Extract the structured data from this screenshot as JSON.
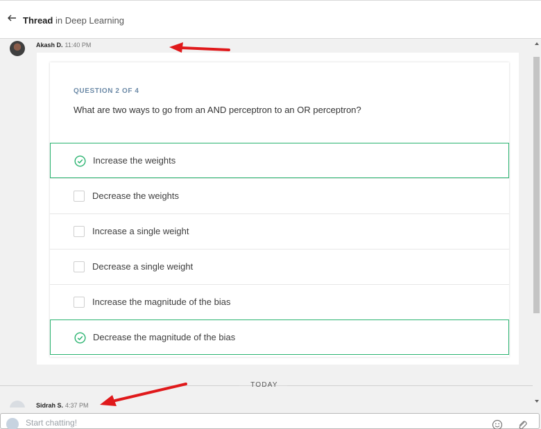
{
  "header": {
    "thread_label": "Thread",
    "in_label": "in",
    "channel": "Deep Learning"
  },
  "messages": [
    {
      "author": "Akash D.",
      "time": "11:40 PM"
    },
    {
      "author": "Sidrah S.",
      "time": "4:37 PM"
    }
  ],
  "quiz": {
    "question_number": "QUESTION 2 OF 4",
    "question": "What are two ways to go from an AND perceptron to an OR perceptron?",
    "options": [
      {
        "label": "Increase the weights",
        "checked": true
      },
      {
        "label": "Decrease the weights",
        "checked": false
      },
      {
        "label": "Increase a single weight",
        "checked": false
      },
      {
        "label": "Decrease a single weight",
        "checked": false
      },
      {
        "label": "Increase the magnitude of the bias",
        "checked": false
      },
      {
        "label": "Decrease the magnitude of the bias",
        "checked": true
      }
    ]
  },
  "separator": {
    "label": "TODAY"
  },
  "composer": {
    "placeholder": "Start chatting!"
  },
  "colors": {
    "accent_green": "#29b36f",
    "question_number": "#6c8aa7",
    "annotation_arrow": "#e0191b"
  }
}
